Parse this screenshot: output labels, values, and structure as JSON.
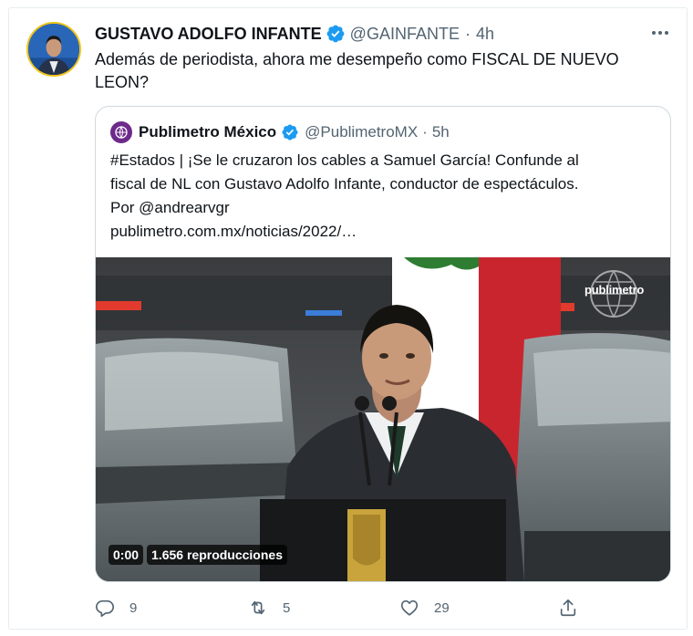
{
  "tweet": {
    "author_name": "GUSTAVO ADOLFO INFANTE",
    "handle": "@GAINFANTE",
    "separator": "·",
    "time": "4h",
    "text_line1": "Además de periodista, ahora me desempeño como FISCAL DE NUEVO",
    "text_line2": "LEON?"
  },
  "quote": {
    "author_name": "Publimetro México",
    "handle": "@PublimetroMX",
    "separator": "·",
    "time": "5h",
    "line1": "#Estados | ¡Se le cruzaron los cables a Samuel García! Confunde al",
    "line2": "fiscal de NL con Gustavo Adolfo Infante, conductor de espectáculos.",
    "line3": "Por @andrearvgr",
    "line4": "publimetro.com.mx/noticias/2022/…",
    "video": {
      "watermark": "publimetro",
      "duration": "0:00",
      "views": "1.656 reproducciones"
    }
  },
  "actions": {
    "replies": "9",
    "retweets": "5",
    "likes": "29"
  },
  "icons": {
    "verified": "verified-badge-icon",
    "more": "more-options-icon",
    "reply": "reply-icon",
    "retweet": "retweet-icon",
    "like": "heart-icon",
    "share": "share-icon"
  },
  "colors": {
    "verified": "#1d9bf0",
    "secondary_text": "#536471",
    "border": "#cfd9de",
    "brand_purple": "#6d2a8a"
  }
}
